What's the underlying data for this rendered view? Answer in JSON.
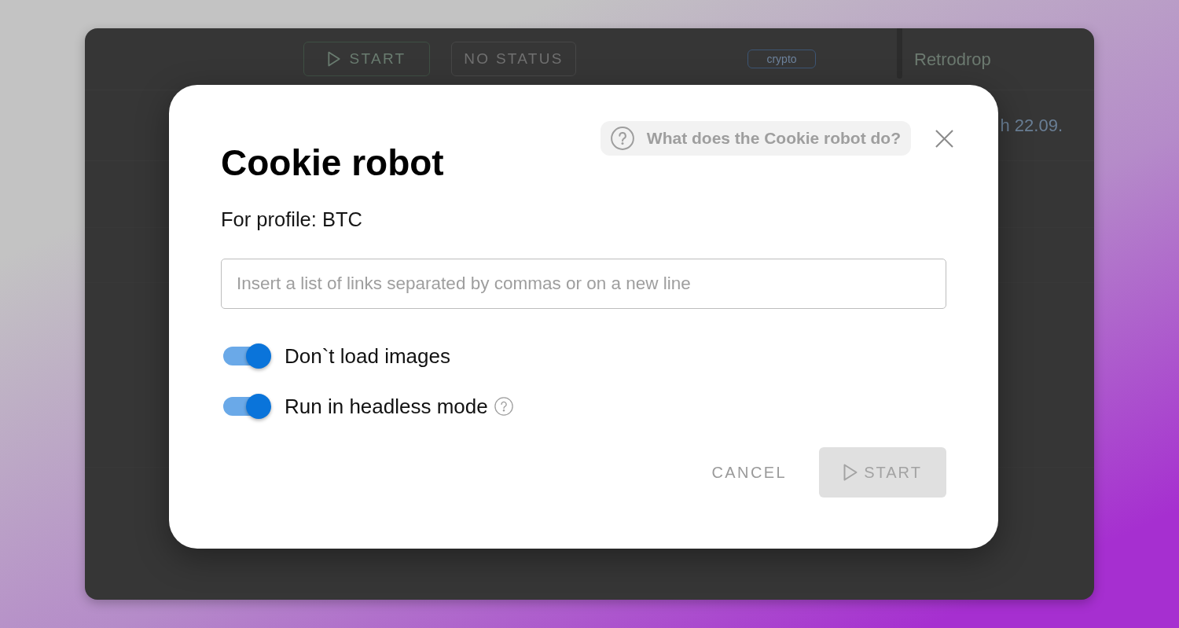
{
  "background_window": {
    "toolbar": {
      "buttons": [
        {
          "label": "START",
          "kind": "start"
        },
        {
          "label": "NO STATUS",
          "kind": "status"
        }
      ],
      "tag": "crypto",
      "column_header": "Retrodrop"
    },
    "row_text": "h 22.09."
  },
  "dialog": {
    "title": "Cookie robot",
    "help_link": "What does the Cookie robot do?",
    "profile": "For profile: BTC",
    "links_field": {
      "placeholder": "Insert a list of links separated by commas or on a new line"
    },
    "options": [
      {
        "label": "Don`t load images",
        "on": true,
        "help": false
      },
      {
        "label": "Run in headless mode",
        "on": true,
        "help": true
      }
    ],
    "buttons": [
      {
        "label": "CANCEL",
        "kind": "text",
        "disabled": false
      },
      {
        "label": "START",
        "kind": "start",
        "disabled": true
      }
    ]
  }
}
